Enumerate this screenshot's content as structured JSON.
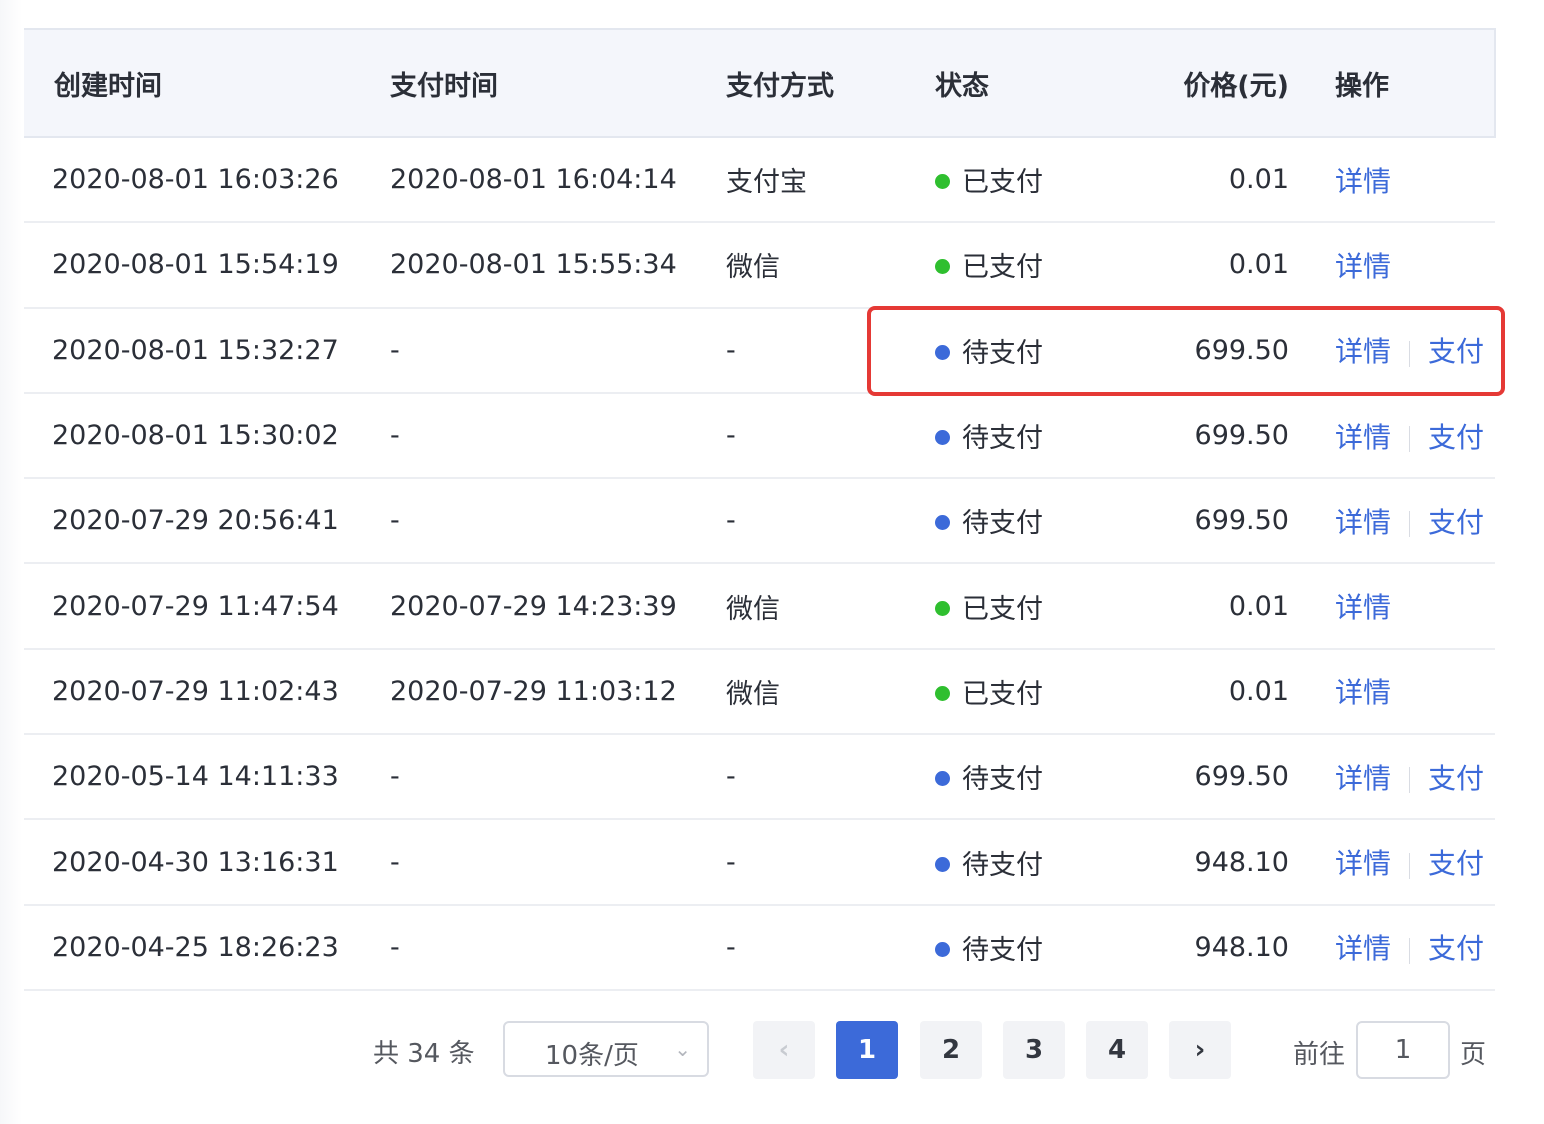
{
  "colors": {
    "paid_dot": "#2fbf2f",
    "pending_dot": "#3c6ad9",
    "link": "#3c6ad9",
    "highlight": "#e53935",
    "page_active": "#3c6ad9"
  },
  "table": {
    "headers": {
      "created": "创建时间",
      "paid": "支付时间",
      "method": "支付方式",
      "status": "状态",
      "price": "价格(元)",
      "op": "操作"
    },
    "rows": [
      {
        "created": "2020-08-01 16:03:26",
        "paid": "2020-08-01 16:04:14",
        "method": "支付宝",
        "status": "已支付",
        "status_type": "paid",
        "price": "0.01",
        "ops": [
          "详情"
        ]
      },
      {
        "created": "2020-08-01 15:54:19",
        "paid": "2020-08-01 15:55:34",
        "method": "微信",
        "status": "已支付",
        "status_type": "paid",
        "price": "0.01",
        "ops": [
          "详情"
        ]
      },
      {
        "created": "2020-08-01 15:32:27",
        "paid": "-",
        "method": "-",
        "status": "待支付",
        "status_type": "pending",
        "price": "699.50",
        "ops": [
          "详情",
          "支付"
        ]
      },
      {
        "created": "2020-08-01 15:30:02",
        "paid": "-",
        "method": "-",
        "status": "待支付",
        "status_type": "pending",
        "price": "699.50",
        "ops": [
          "详情",
          "支付"
        ]
      },
      {
        "created": "2020-07-29 20:56:41",
        "paid": "-",
        "method": "-",
        "status": "待支付",
        "status_type": "pending",
        "price": "699.50",
        "ops": [
          "详情",
          "支付"
        ]
      },
      {
        "created": "2020-07-29 11:47:54",
        "paid": "2020-07-29 14:23:39",
        "method": "微信",
        "status": "已支付",
        "status_type": "paid",
        "price": "0.01",
        "ops": [
          "详情"
        ]
      },
      {
        "created": "2020-07-29 11:02:43",
        "paid": "2020-07-29 11:03:12",
        "method": "微信",
        "status": "已支付",
        "status_type": "paid",
        "price": "0.01",
        "ops": [
          "详情"
        ]
      },
      {
        "created": "2020-05-14 14:11:33",
        "paid": "-",
        "method": "-",
        "status": "待支付",
        "status_type": "pending",
        "price": "699.50",
        "ops": [
          "详情",
          "支付"
        ]
      },
      {
        "created": "2020-04-30 13:16:31",
        "paid": "-",
        "method": "-",
        "status": "待支付",
        "status_type": "pending",
        "price": "948.10",
        "ops": [
          "详情",
          "支付"
        ]
      },
      {
        "created": "2020-04-25 18:26:23",
        "paid": "-",
        "method": "-",
        "status": "待支付",
        "status_type": "pending",
        "price": "948.10",
        "ops": [
          "详情",
          "支付"
        ]
      }
    ]
  },
  "pagination": {
    "total_label": "共 34 条",
    "page_size": "10条/页",
    "prev_icon": "chevron-left-icon",
    "next_icon": "chevron-right-icon",
    "pages": [
      "1",
      "2",
      "3",
      "4"
    ],
    "current_page": "1",
    "goto_prefix": "前往",
    "goto_value": "1",
    "goto_suffix": "页"
  }
}
